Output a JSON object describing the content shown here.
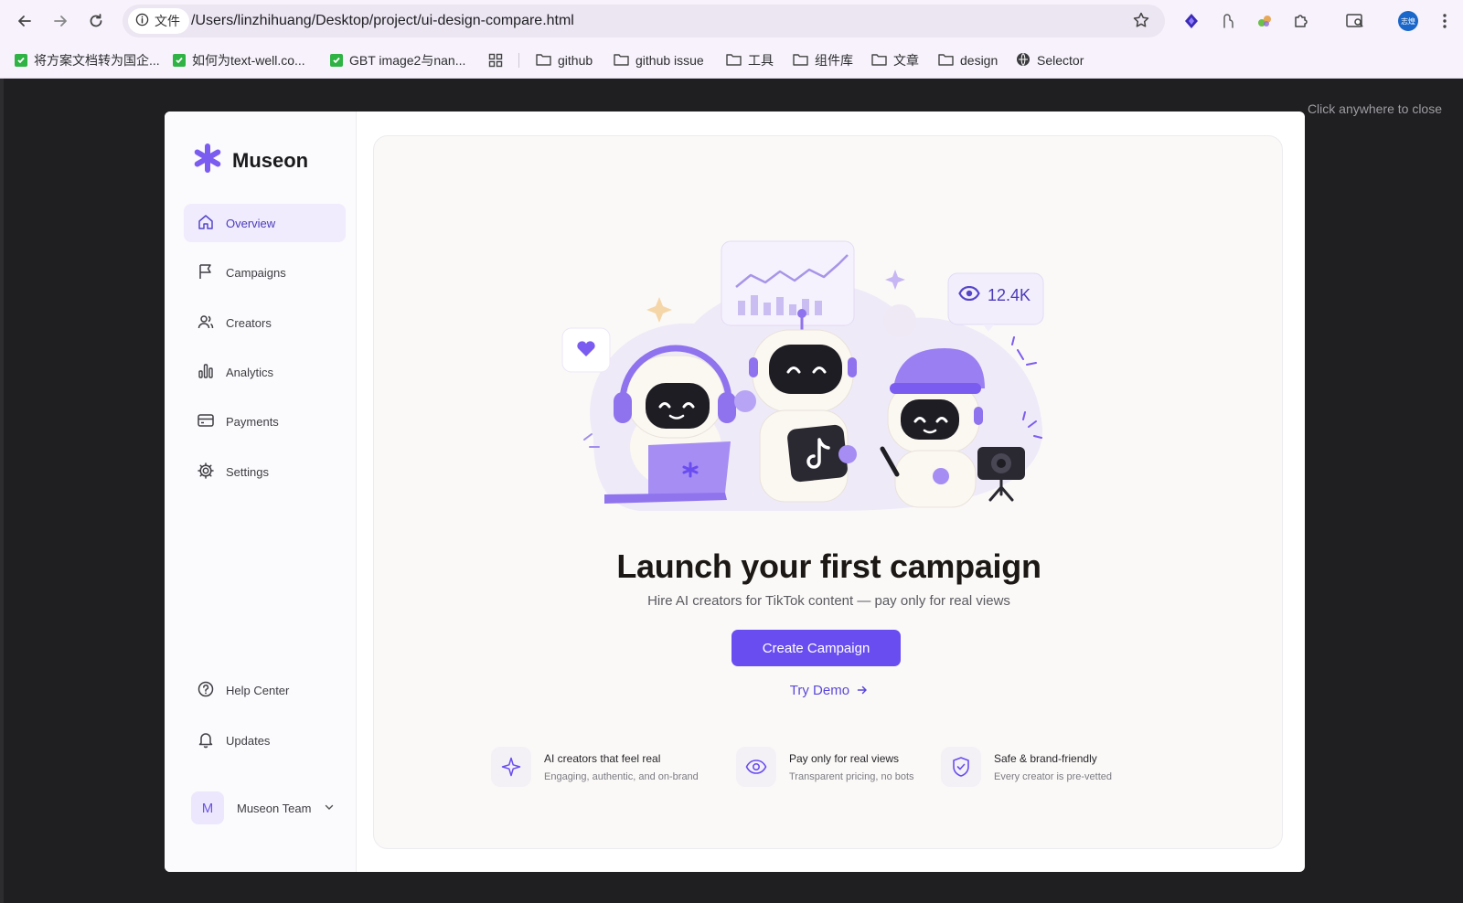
{
  "browser": {
    "site_chip": "文件",
    "url": "/Users/linzhihuang/Desktop/project/ui-design-compare.html",
    "avatar_label": "志煌",
    "bookmarks": [
      {
        "label": "将方案文档转为国企...",
        "type": "check"
      },
      {
        "label": "如何为text-well.co...",
        "type": "check"
      },
      {
        "label": "GBT image2与nan...",
        "type": "check"
      },
      {
        "label": "github",
        "type": "folder"
      },
      {
        "label": "github issue",
        "type": "folder"
      },
      {
        "label": "工具",
        "type": "folder"
      },
      {
        "label": "组件库",
        "type": "folder"
      },
      {
        "label": "文章",
        "type": "folder"
      },
      {
        "label": "design",
        "type": "folder"
      },
      {
        "label": "Selector",
        "type": "globe"
      }
    ]
  },
  "overlay": {
    "close_hint": "Click anywhere to close"
  },
  "sidebar": {
    "brand": "Museon",
    "items": [
      {
        "label": "Overview",
        "icon": "home-icon",
        "active": true
      },
      {
        "label": "Campaigns",
        "icon": "flag-icon"
      },
      {
        "label": "Creators",
        "icon": "users-icon"
      },
      {
        "label": "Analytics",
        "icon": "bar-chart-icon"
      },
      {
        "label": "Payments",
        "icon": "card-icon"
      },
      {
        "label": "Settings",
        "icon": "gear-icon"
      }
    ],
    "footer_items": [
      {
        "label": "Help Center",
        "icon": "help-circle-icon"
      },
      {
        "label": "Updates",
        "icon": "bell-icon"
      }
    ],
    "team": {
      "initial": "M",
      "name": "Museon Team"
    }
  },
  "main": {
    "views_badge": "12.4K",
    "headline": "Launch your first campaign",
    "subheadline": "Hire AI creators for TikTok content — pay only for real views",
    "cta_label": "Create Campaign",
    "demo_label": "Try Demo",
    "features": [
      {
        "title": "AI creators that feel real",
        "desc": "Engaging, authentic, and on-brand",
        "icon": "sparkle-icon"
      },
      {
        "title": "Pay only for real views",
        "desc": "Transparent pricing, no bots",
        "icon": "eye-icon"
      },
      {
        "title": "Safe & brand-friendly",
        "desc": "Every creator is pre-vetted",
        "icon": "shield-check-icon"
      }
    ]
  },
  "colors": {
    "accent": "#6a4df0",
    "active_bg": "#f0ecfd",
    "backdrop": "#1f1f21"
  }
}
